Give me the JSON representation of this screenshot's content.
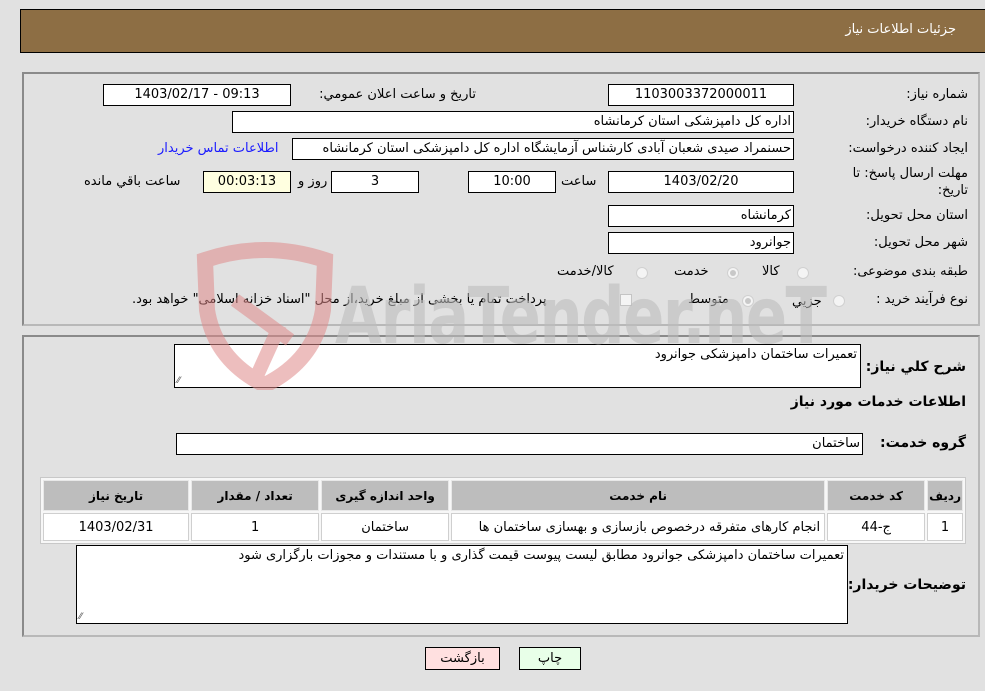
{
  "header": {
    "title": "جزئيات اطلاعات نياز"
  },
  "info": {
    "need_number_label": "شماره نياز:",
    "need_number": "1103003372000011",
    "announce_label": "تاريخ و ساعت اعلان عمومي:",
    "announce_value": "1403/02/17 - 09:13",
    "buyer_org_label": "نام دستگاه خريدار:",
    "buyer_org": "اداره کل دامپزشکی استان کرمانشاه",
    "creator_label": "ايجاد کننده درخواست:",
    "creator": "حسنمراد صیدی شعبان آبادی کارشناس آزمایشگاه اداره کل دامپزشکی استان کرمانشاه",
    "contact_link": "اطلاعات تماس خريدار",
    "deadline_label": "مهلت ارسال پاسخ: تا تاريخ:",
    "deadline_date": "1403/02/20",
    "time_label": "ساعت",
    "deadline_time": "10:00",
    "days": "3",
    "days_label": "روز و",
    "remaining_time": "00:03:13",
    "remaining_label": "ساعت باقي مانده",
    "province_label": "استان محل تحويل:",
    "province": "کرمانشاه",
    "city_label": "شهر محل تحويل:",
    "city": "جوانرود",
    "category_label": "طبقه بندی موضوعی:",
    "category_options": [
      "کالا",
      "خدمت",
      "کالا/خدمت"
    ],
    "category_selected": "خدمت",
    "process_label": "نوع فرآيند خريد :",
    "process_options": [
      "جزيي",
      "متوسط"
    ],
    "process_selected": "متوسط",
    "payment_note": "پرداخت تمام يا بخشی از مبلغ خريد،از محل \"اسناد خزانه اسلامی\" خواهد بود.",
    "payment_checked": false
  },
  "details": {
    "summary_label": "شرح کلي نياز:",
    "summary": "تعمیرات ساختمان دامپزشکی جوانرود",
    "services_heading": "اطلاعات خدمات مورد نياز",
    "service_group_label": "گروه خدمت:",
    "service_group": "ساختمان",
    "table": {
      "headers": [
        "رديف",
        "کد خدمت",
        "نام خدمت",
        "واحد اندازه گيری",
        "تعداد / مقدار",
        "تاريخ نياز"
      ],
      "rows": [
        [
          "1",
          "ج-44",
          "انجام کارهای متفرقه درخصوص بازسازی و بهسازی ساختمان ها",
          "ساختمان",
          "1",
          "1403/02/31"
        ]
      ]
    },
    "buyer_notes_label": "توضيحات خريدار:",
    "buyer_notes": "تعمیرات ساختمان دامپزشکی جوانرود مطابق لیست پیوست قیمت گذاری و با مستندات و مجوزات بارگزاری شود"
  },
  "buttons": {
    "print": "چاپ",
    "back": "بازگشت"
  },
  "watermark": {
    "text": "AriaTender.neT"
  },
  "colors": {
    "header_bg": "#8d6e44",
    "link": "#1a1aff",
    "back_btn": "#ffe0e0",
    "print_btn": "#e8ffe8",
    "remaining_bg": "#ffffe0"
  }
}
